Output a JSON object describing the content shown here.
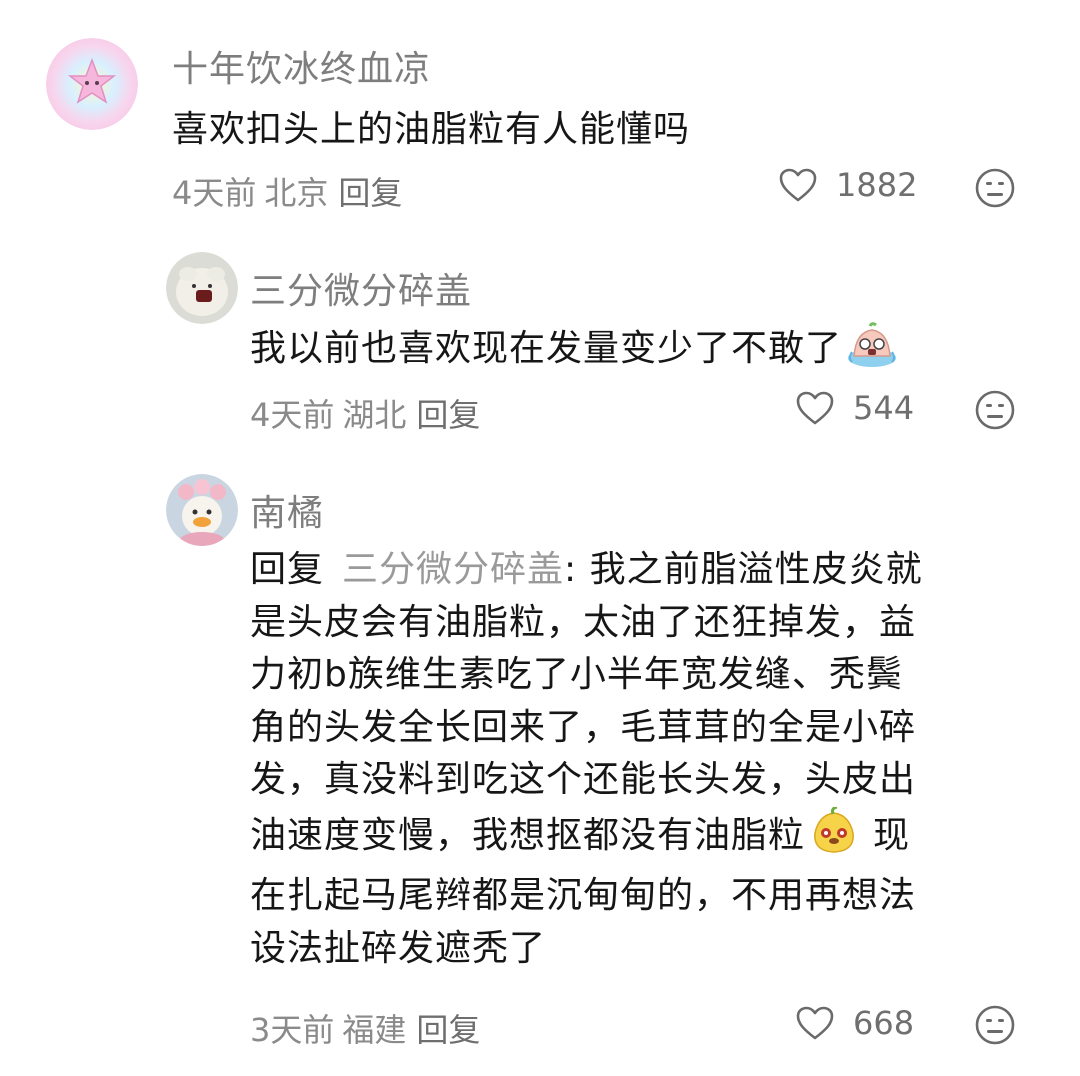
{
  "comments": [
    {
      "username": "十年饮冰终血凉",
      "text": "喜欢扣头上的油脂粒有人能懂吗",
      "time": "4天前",
      "location": "北京",
      "reply_label": "回复",
      "likes": "1882",
      "avatar_icon": "pink-star-avatar"
    },
    {
      "username": "三分微分碎盖",
      "text": "我以前也喜欢现在发量变少了不敢了",
      "emoji": "crying-emoji",
      "time": "4天前",
      "location": "湖北",
      "reply_label": "回复",
      "likes": "544",
      "avatar_icon": "white-creature-avatar"
    },
    {
      "username": "南橘",
      "reply_prefix": "回复",
      "reply_target": "三分微分碎盖",
      "reply_sep": ":",
      "text_lines": [
        "我之前脂溢性皮炎就",
        "是头皮会有油脂粒，太油了还狂掉发，益",
        "力初b族维生素吃了小半年宽发缝、秃鬓",
        "角的头发全长回来了，毛茸茸的全是小碎",
        "发，真没料到吃这个还能长头发，头皮出",
        "油速度变慢，我想抠都没有油脂粒",
        "现",
        "在扎起马尾辫都是沉甸甸的，不用再想法",
        "设法扯碎发遮秃了"
      ],
      "emoji": "pear-blush-emoji",
      "time": "3天前",
      "location": "福建",
      "reply_label": "回复",
      "likes": "668",
      "avatar_icon": "duck-avatar"
    }
  ],
  "icons": {
    "like": "heart-outline-icon",
    "react": "neutral-face-icon"
  },
  "colors": {
    "username": "#7e7e7e",
    "text": "#161616",
    "meta": "#8a8a8a"
  }
}
